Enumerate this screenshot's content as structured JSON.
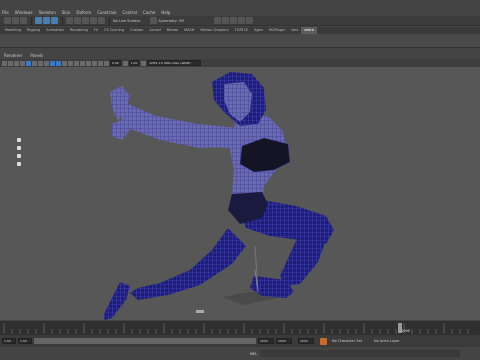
{
  "menubar": {
    "items": [
      "File",
      "Windows",
      "Skeleton",
      "Skin",
      "Deform",
      "Constrain",
      "Control",
      "Cache",
      "Help"
    ]
  },
  "statusline": {
    "mode_label": "No Live Surface",
    "symmetry": "Symmetry: Off"
  },
  "shelf": {
    "tabs": [
      "Modeling",
      "Rigging",
      "Animation",
      "Rendering",
      "FX",
      "FX Caching",
      "Custom",
      "Arnold",
      "Bifrost",
      "MASH",
      "Motion Graphics",
      "TURTLE",
      "Xgen",
      "MGPlugin",
      "test",
      "zebra"
    ],
    "active_index": 15
  },
  "panel_menu": [
    "Renderer",
    "Panels"
  ],
  "panel_toolbar": {
    "value_a": "0.00",
    "value_b": "1.00",
    "colorspace": "ACES 1.0 SDR-video (sRGB)"
  },
  "timeline": {
    "current_frame": "1000",
    "start": "1.00",
    "end": "1000"
  },
  "range": {
    "start": "1.00",
    "inner_start": "1.00",
    "inner_end": "1000",
    "end": "1000"
  },
  "commandline": {
    "label": "MEL",
    "character_set": "No Character Set",
    "anim_layer": "No Anim Layer"
  },
  "colors": {
    "wire": "#2a2aa8",
    "skin_wire": "#4848c8",
    "viewport": "#575757"
  }
}
